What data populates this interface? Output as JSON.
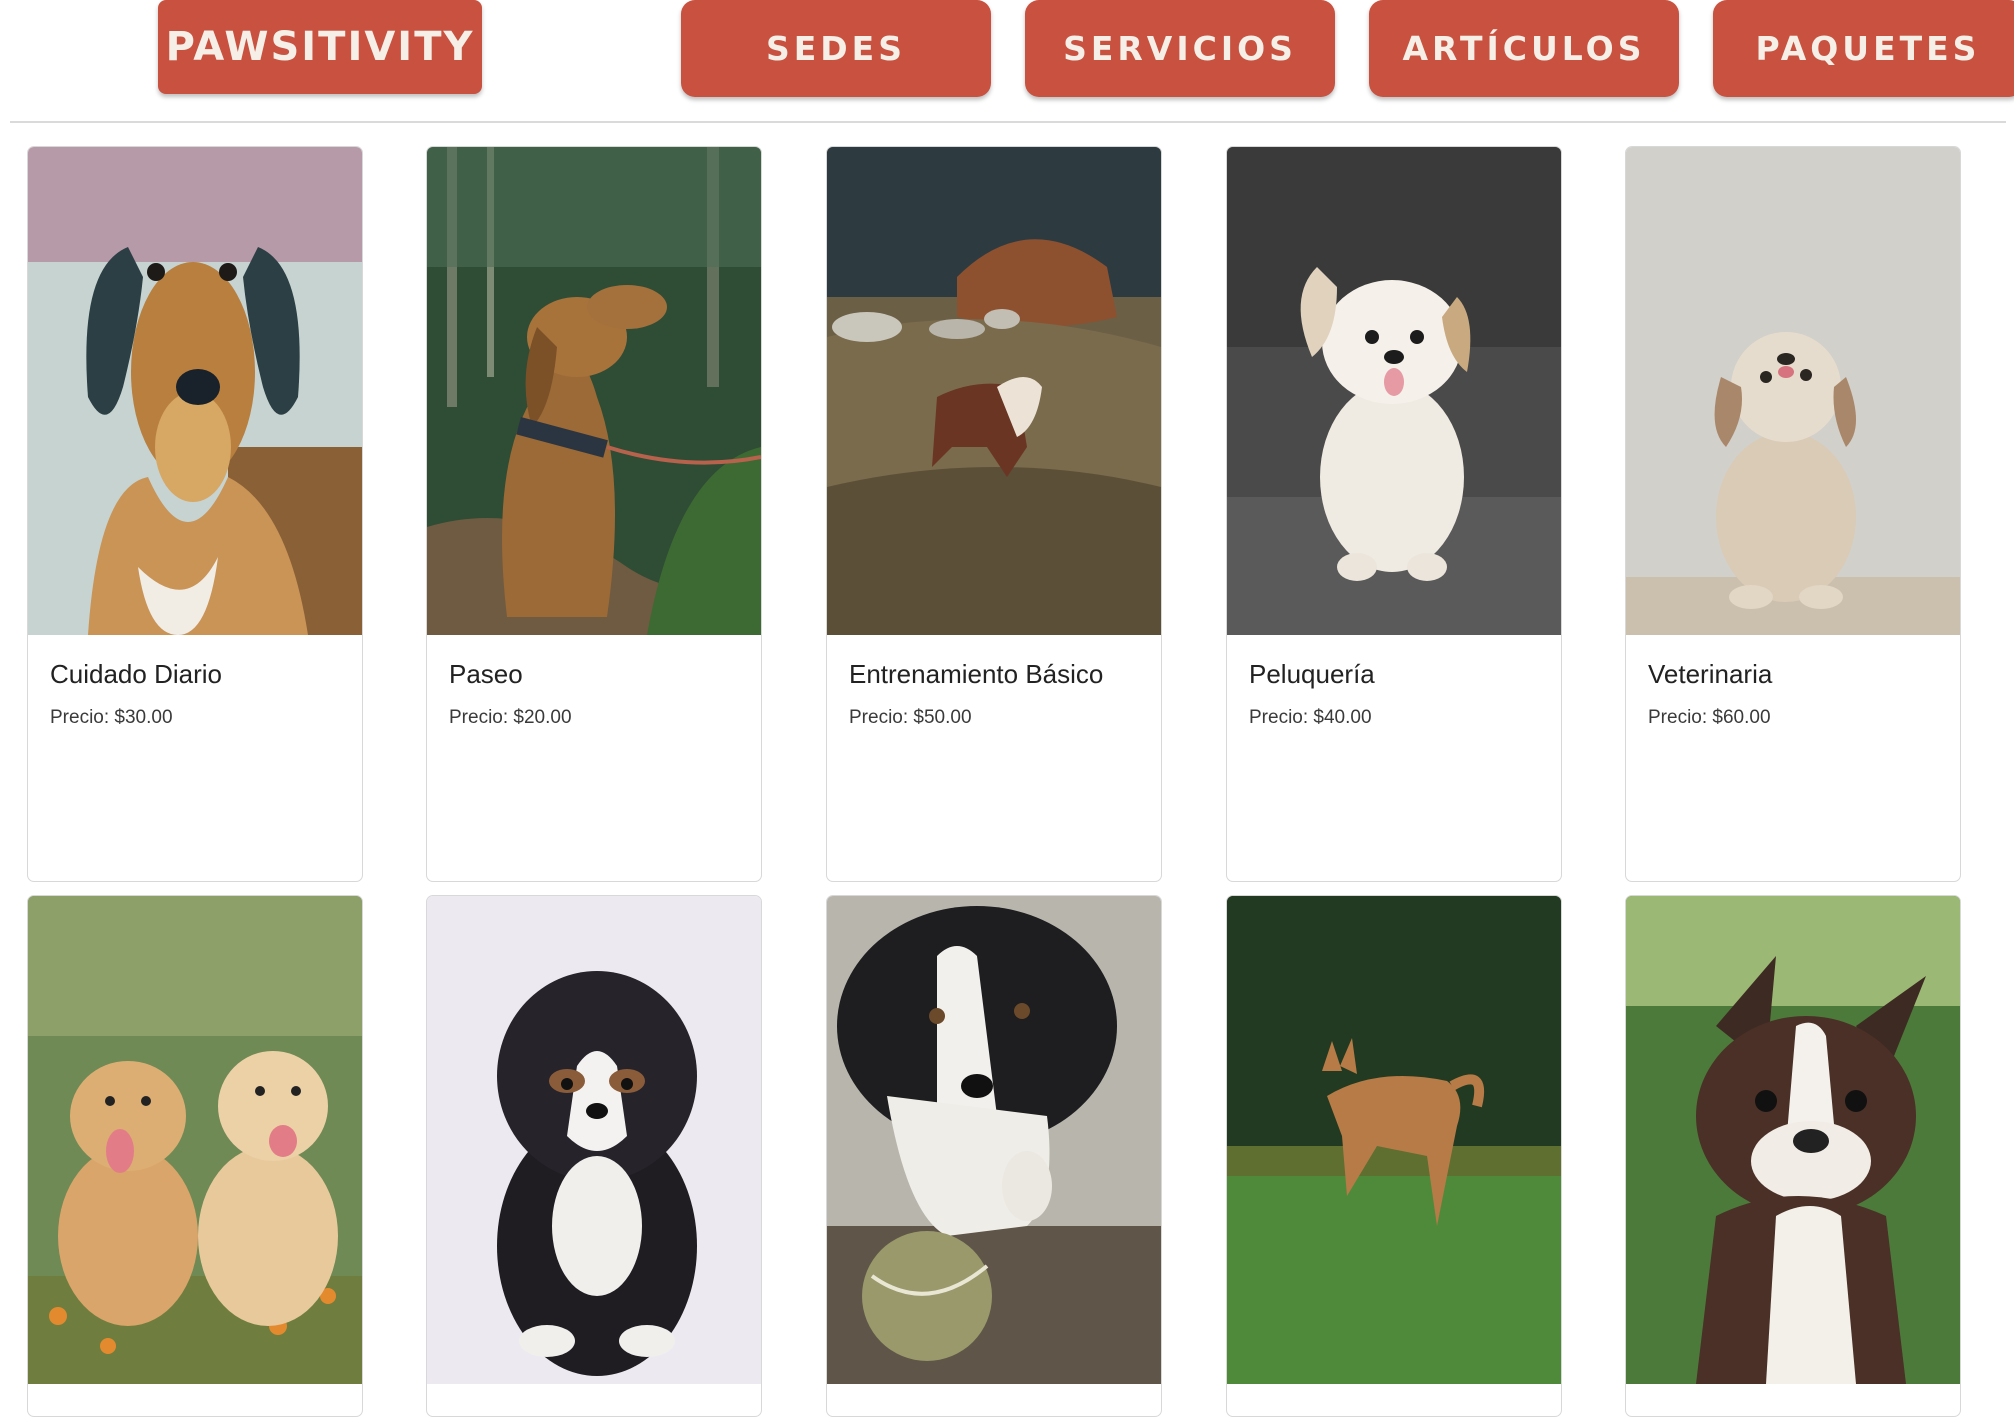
{
  "header": {
    "brand": "PAWSITIVITY",
    "nav": [
      "SEDES",
      "SERVICIOS",
      "ARTÍCULOS",
      "PAQUETES"
    ]
  },
  "services": [
    {
      "title": "Cuidado Diario",
      "price": "Precio: $30.00",
      "photo": "saluki-dog-photo"
    },
    {
      "title": "Paseo",
      "price": "Precio: $20.00",
      "photo": "spaniel-on-leash-photo"
    },
    {
      "title": "Entrenamiento Básico",
      "price": "Precio: $50.00",
      "photo": "collie-on-hill-photo"
    },
    {
      "title": "Peluquería",
      "price": "Precio: $40.00",
      "photo": "white-shih-tzu-photo"
    },
    {
      "title": "Veterinaria",
      "price": "Precio: $60.00",
      "photo": "beige-shih-tzu-photo"
    }
  ],
  "products": [
    {
      "photo": "golden-puppies-photo"
    },
    {
      "photo": "bernedoodle-puppy-photo"
    },
    {
      "photo": "border-collie-ball-photo"
    },
    {
      "photo": "jumping-dog-grass-photo"
    },
    {
      "photo": "boston-terrier-photo"
    }
  ],
  "colors": {
    "accent": "#c85140",
    "nav_text": "#f6efe7",
    "card_border": "#d8d8d8"
  }
}
